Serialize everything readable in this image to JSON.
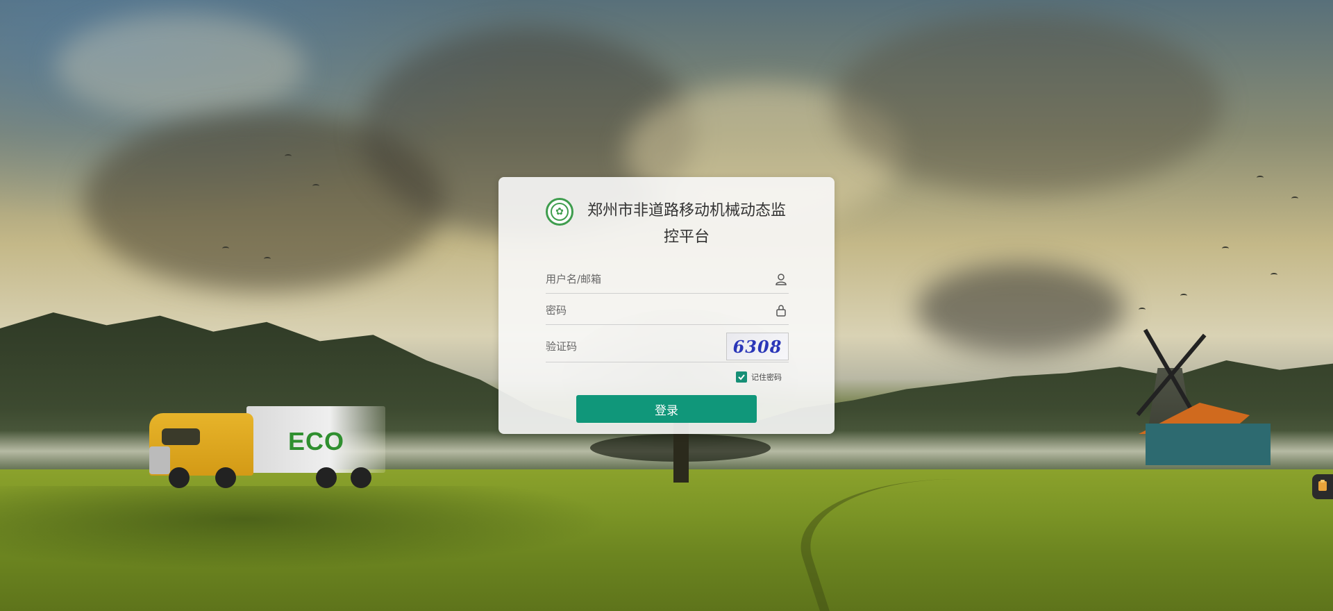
{
  "login": {
    "title": "郑州市非道路移动机械动态监控平台",
    "username_placeholder": "用户名/邮箱",
    "password_placeholder": "密码",
    "captcha_placeholder": "验证码",
    "captcha_code": "6308",
    "remember_label": "记住密码",
    "remember_checked": true,
    "login_button": "登录"
  },
  "background": {
    "truck_text": "ECO"
  },
  "icons": {
    "logo": "environment-emblem-icon",
    "username": "user-icon",
    "password": "lock-icon",
    "side_tab": "clipboard-icon"
  },
  "colors": {
    "accent": "#10977a",
    "checkbox": "#168f76",
    "logo_green": "#3f9d4e"
  }
}
